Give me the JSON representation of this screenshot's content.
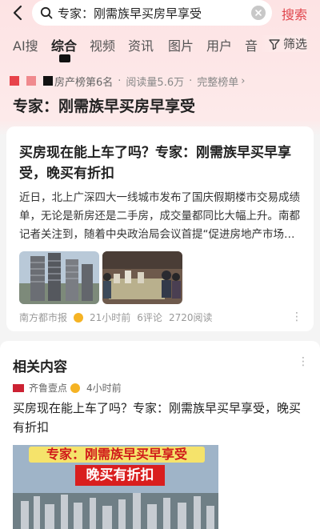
{
  "search": {
    "query": "专家：刚需族早买房早享受",
    "button_label": "搜索"
  },
  "tabs": [
    {
      "label": "AI搜"
    },
    {
      "label": "综合"
    },
    {
      "label": "视频"
    },
    {
      "label": "资讯"
    },
    {
      "label": "图片"
    },
    {
      "label": "用户"
    },
    {
      "label": "音"
    }
  ],
  "filter_label": "筛选",
  "hot": {
    "rank_text": "房产榜第6名",
    "read_text": "阅读量5.6万",
    "full_list_text": "完整榜单",
    "title": "专家：刚需族早买房早享受"
  },
  "card": {
    "title": "买房现在能上车了吗？专家：刚需族早买早享受，晚买有折扣",
    "desc": "近日，北上广深四大一线城市发布了国庆假期楼市交易成绩单，无论是新房还是二手房，成交量都同比大幅上升。南都记者关注到，随着中央政治局会议首提“促进房地产市场…",
    "source": "南方都市报",
    "time": "21小时前",
    "comments": "6评论",
    "reads": "2720阅读",
    "more": "⋮"
  },
  "related": {
    "heading": "相关内容",
    "more": "⋮",
    "source": "齐鲁壹点",
    "time": "4小时前",
    "title": "买房现在能上车了吗？专家：刚需族早买早享受，晚买有折扣",
    "img_text_1": "专家：刚需族早买早享受",
    "img_text_2": "晚买有折扣"
  },
  "colors": {
    "accent": "#e0454c",
    "badge": "#f5b324"
  }
}
